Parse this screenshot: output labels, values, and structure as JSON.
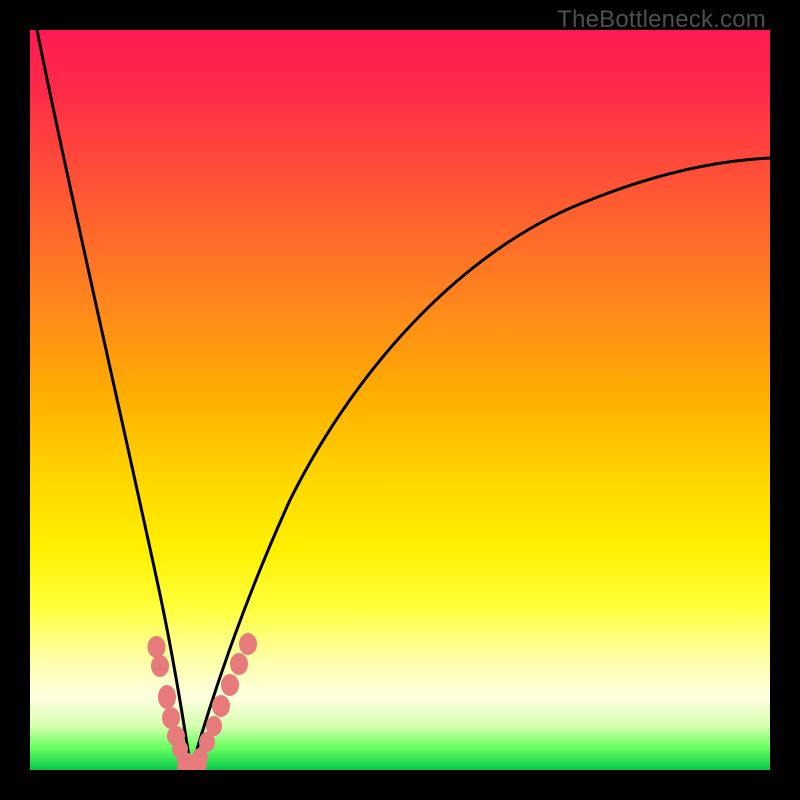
{
  "watermark": "TheBottleneck.com",
  "gradient_colors": {
    "top": "#ff1a52",
    "mid_upper": "#ff8a1a",
    "mid": "#ffd400",
    "mid_lower": "#ffff3a",
    "near_bottom": "#ffffe0",
    "bottom": "#05c84a"
  },
  "chart_data": {
    "type": "line",
    "title": "",
    "xlabel": "",
    "ylabel": "",
    "xlim": [
      0,
      100
    ],
    "ylim": [
      0,
      100
    ],
    "grid": false,
    "legend": false,
    "series": [
      {
        "name": "left-curve",
        "x": [
          1,
          3,
          5,
          7,
          9,
          11,
          13,
          15,
          17,
          18.5,
          19.6,
          20.5,
          21.2,
          21.8
        ],
        "y": [
          100,
          86,
          73,
          61,
          50,
          40,
          31,
          23,
          15,
          9,
          5,
          2.5,
          1,
          0
        ]
      },
      {
        "name": "right-curve",
        "x": [
          21.8,
          23,
          24.5,
          26,
          28,
          31,
          35,
          40,
          46,
          53,
          61,
          70,
          80,
          90,
          100
        ],
        "y": [
          0,
          2,
          5,
          8,
          12,
          18,
          25,
          33,
          41,
          49,
          57,
          64,
          71,
          77,
          82
        ]
      }
    ],
    "markers": [
      {
        "name": "left-branch-markers",
        "points": [
          {
            "x": 17.1,
            "y": 16.5
          },
          {
            "x": 17.6,
            "y": 14.0
          },
          {
            "x": 18.5,
            "y": 9.8
          },
          {
            "x": 19.1,
            "y": 7.0
          },
          {
            "x": 19.7,
            "y": 4.6
          },
          {
            "x": 20.3,
            "y": 2.8
          },
          {
            "x": 20.9,
            "y": 1.3
          }
        ]
      },
      {
        "name": "right-branch-markers",
        "points": [
          {
            "x": 23.0,
            "y": 1.8
          },
          {
            "x": 23.9,
            "y": 3.8
          },
          {
            "x": 24.8,
            "y": 6.0
          },
          {
            "x": 25.8,
            "y": 8.6
          },
          {
            "x": 27.0,
            "y": 11.5
          },
          {
            "x": 28.2,
            "y": 14.3
          },
          {
            "x": 29.4,
            "y": 17.0
          }
        ]
      },
      {
        "name": "bottom-markers",
        "points": [
          {
            "x": 21.2,
            "y": 0.4
          },
          {
            "x": 22.6,
            "y": 0.6
          }
        ]
      }
    ],
    "marker_color": "#e77a7a",
    "marker_border": "#7a2626",
    "marker_radius_px": 9,
    "frame_color": "#000000",
    "frame_thickness_px": 30
  }
}
